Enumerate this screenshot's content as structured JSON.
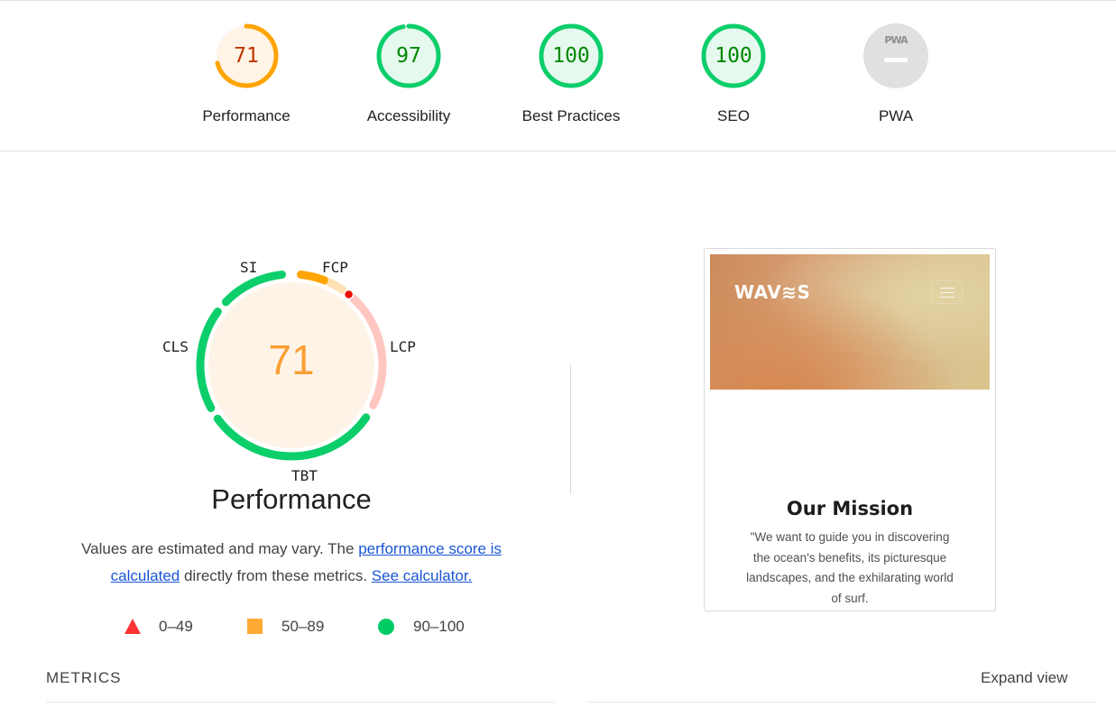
{
  "colors": {
    "pass": "#0cce6b",
    "average": "#ffa400",
    "fail": "#ff4e42",
    "average_text": "#c33300",
    "pass_text": "#008800",
    "link": "#1a55d4"
  },
  "categories": [
    {
      "label": "Performance",
      "score": "71",
      "value": 0.71,
      "rating": "average"
    },
    {
      "label": "Accessibility",
      "score": "97",
      "value": 0.97,
      "rating": "pass"
    },
    {
      "label": "Best Practices",
      "score": "100",
      "value": 1.0,
      "rating": "pass"
    },
    {
      "label": "SEO",
      "score": "100",
      "value": 1.0,
      "rating": "pass"
    },
    {
      "label": "PWA",
      "badge_text": "PWA",
      "rating": "na"
    }
  ],
  "performance": {
    "score": "71",
    "title": "Performance",
    "metric_labels": {
      "si": "SI",
      "fcp": "FCP",
      "lcp": "LCP",
      "tbt": "TBT",
      "cls": "CLS"
    },
    "description": {
      "before": "Values are estimated and may vary. The ",
      "link1": "performance score is calculated",
      "middle": " directly from these metrics. ",
      "link2": "See calculator."
    },
    "legend": [
      {
        "shape": "triangle-icon",
        "range": "0–49"
      },
      {
        "shape": "square-icon",
        "range": "50–89"
      },
      {
        "shape": "circle-icon",
        "range": "90–100"
      }
    ]
  },
  "screenshot": {
    "logo": "WAV≋S",
    "mission_title": "Our Mission",
    "mission_text": "\"We want to guide you in discovering the ocean's benefits, its picturesque landscapes, and the exhilarating world of surf."
  },
  "metrics_section": {
    "heading": "METRICS",
    "expand": "Expand view"
  }
}
